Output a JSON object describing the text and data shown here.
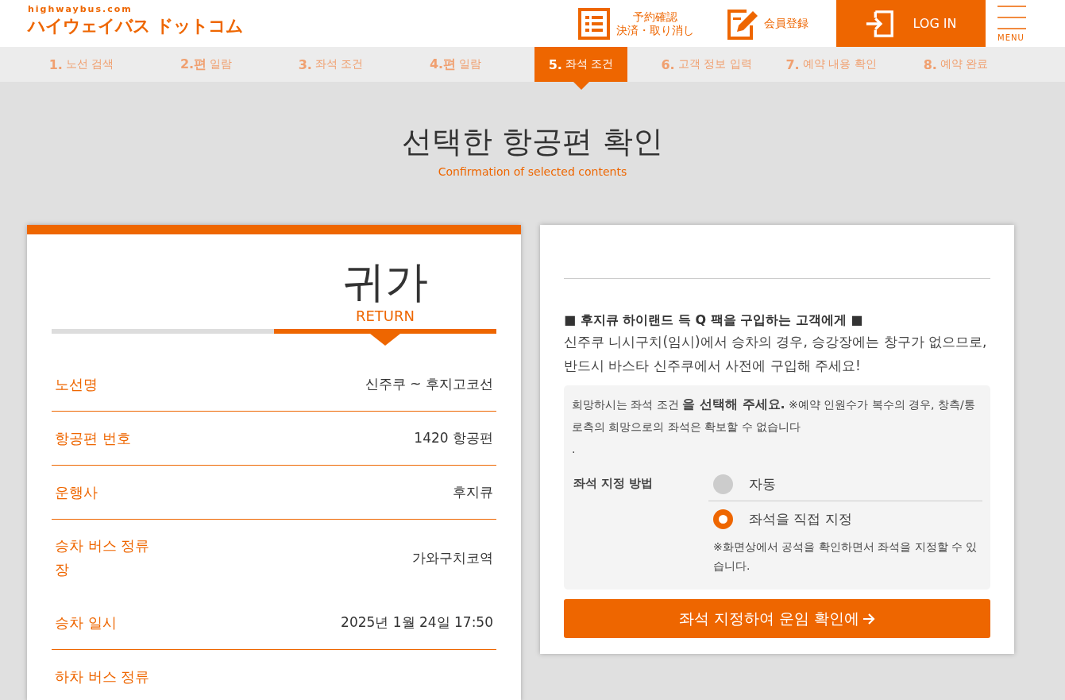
{
  "header": {
    "logo_top": "highwaybus.com",
    "logo": "ハイウェイバス ドットコム",
    "nav": [
      {
        "kind": "list",
        "lines": [
          "予約確認",
          "決済・取り消し"
        ]
      },
      {
        "kind": "pencil",
        "lines": [
          "会員登録"
        ]
      }
    ],
    "login": "LOG IN",
    "menu": "MENU"
  },
  "steps": [
    {
      "num": "1.",
      "label": "노선 검색",
      "selected": false
    },
    {
      "num": "2.편",
      "label": "일람",
      "selected": false
    },
    {
      "num": "3.",
      "label": "좌석 조건",
      "selected": false
    },
    {
      "num": "4.편",
      "label": "일람",
      "selected": false
    },
    {
      "num": "5.",
      "label": "좌석 조건",
      "selected": true
    },
    {
      "num": "6.",
      "label": "고객 정보 입력",
      "selected": false
    },
    {
      "num": "7.",
      "label": "예약 내용 확인",
      "selected": false
    },
    {
      "num": "8.",
      "label": "예약 완료",
      "selected": false
    }
  ],
  "page_title": "선택한 항공편 확인",
  "page_subtitle": "Confirmation of selected contents",
  "trip": {
    "title": "귀가",
    "subtitle": "RETURN",
    "segments": [
      {
        "selected": false
      },
      {
        "selected": true
      }
    ],
    "rows": [
      {
        "label": "노선명",
        "value": "신주쿠 ~ 후지고코선"
      },
      {
        "label": "항공편 번호",
        "value": "1420 항공편"
      },
      {
        "label": "운행사",
        "value": "후지큐"
      },
      {
        "label": "승차 버스 정류장",
        "value": "가와구치코역"
      },
      {
        "label": "승차 일시",
        "value": "2025년 1월 24일 17:50"
      },
      {
        "label": "하차 버스 정류"
      }
    ]
  },
  "seat": {
    "notice_title": "■ 후지큐 하이랜드 득 Q 팩을 구입하는 고객에게 ■",
    "notice_text": "신주쿠 니시구치(임시)에서 승차의 경우, 승강장에는 창구가 없으므로, 반드시 바스타 신주쿠에서 사전에 구입해 주세요!",
    "instruction": "희망하시는 좌석 조건 **을 선택해 주세요.** ※예약 인원수가 복수의 경우, 창측/통로측의 희망으로의 좌석은 확보할 수 없습니다",
    "instruction_end": ".",
    "method_label": "좌석 지정 방법",
    "options": [
      {
        "label": "자동",
        "selected": false
      },
      {
        "label": "좌석을 직접 지정",
        "selected": true,
        "note": "※화면상에서 공석을 확인하면서 좌석을 지정할 수 있습니다."
      }
    ],
    "button": "좌석 지정하여 운임 확인에"
  }
}
